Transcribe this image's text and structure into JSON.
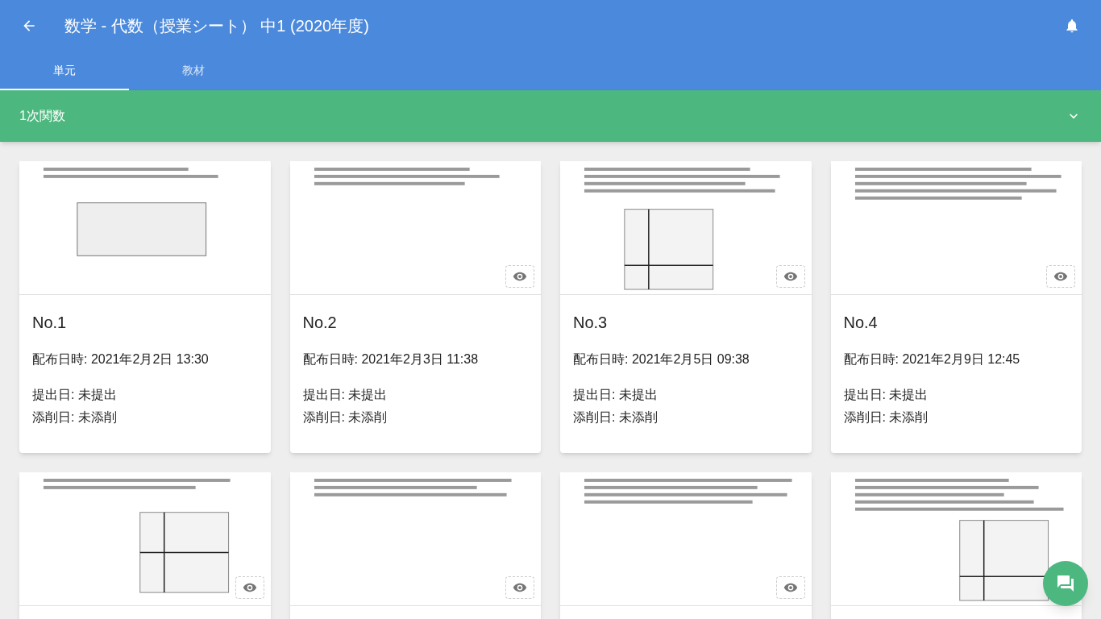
{
  "header": {
    "title": "数学 - 代数（授業シート） 中1 (2020年度)"
  },
  "tabs": [
    {
      "label": "単元",
      "selected": true
    },
    {
      "label": "教材",
      "selected": false
    }
  ],
  "unit": {
    "label": "1次関数",
    "expanded": false
  },
  "cards": [
    {
      "title": "No.1",
      "distributed": "配布日時: 2021年2月2日 13:30",
      "submitted": "提出日: 未提出",
      "corrected": "添削日: 未添削",
      "preview": false
    },
    {
      "title": "No.2",
      "distributed": "配布日時: 2021年2月3日 11:38",
      "submitted": "提出日: 未提出",
      "corrected": "添削日: 未添削",
      "preview": true
    },
    {
      "title": "No.3",
      "distributed": "配布日時: 2021年2月5日 09:38",
      "submitted": "提出日: 未提出",
      "corrected": "添削日: 未添削",
      "preview": true
    },
    {
      "title": "No.4",
      "distributed": "配布日時: 2021年2月9日 12:45",
      "submitted": "提出日: 未提出",
      "corrected": "添削日: 未添削",
      "preview": true
    },
    {
      "preview": true
    },
    {
      "preview": true
    },
    {
      "preview": true
    },
    {
      "preview": false
    }
  ]
}
